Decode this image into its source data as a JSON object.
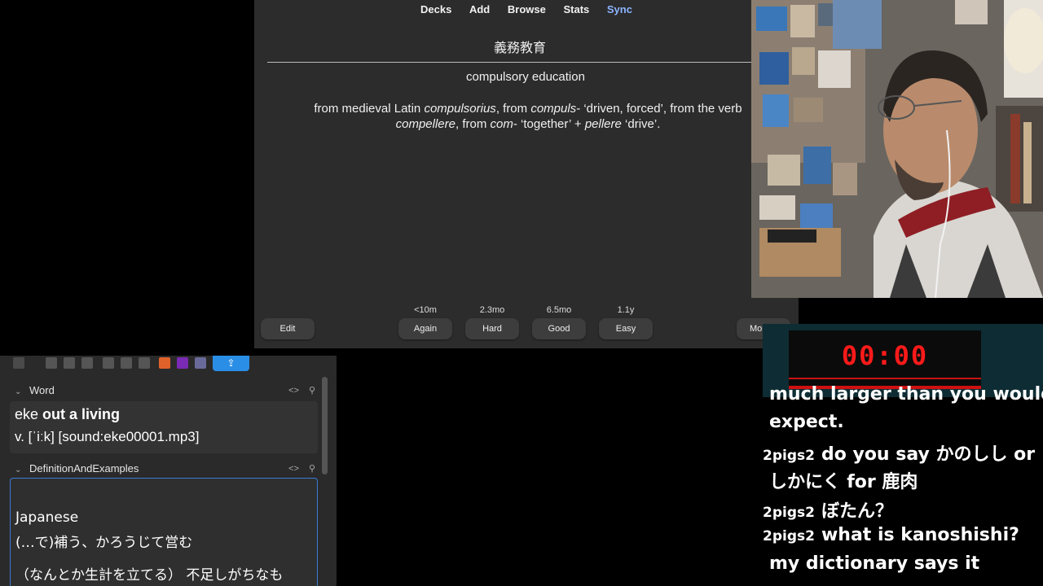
{
  "anki": {
    "nav": [
      "Decks",
      "Add",
      "Browse",
      "Stats",
      "Sync"
    ],
    "nav_active": "Sync",
    "card": {
      "front": "義務教育",
      "meaning": "compulsory education",
      "etymology": [
        {
          "t": "from medieval Latin ",
          "i": false
        },
        {
          "t": "compulsorius",
          "i": true
        },
        {
          "t": ", from ",
          "i": false
        },
        {
          "t": "compuls",
          "i": true
        },
        {
          "t": "- ‘driven, forced’, from the verb ",
          "i": false
        },
        {
          "t": "compellere",
          "i": true
        },
        {
          "t": ", from ",
          "i": false
        },
        {
          "t": "com",
          "i": true
        },
        {
          "t": "- ‘together’ + ",
          "i": false
        },
        {
          "t": "pellere",
          "i": true
        },
        {
          "t": " ‘drive’.",
          "i": false
        }
      ]
    },
    "buttons": {
      "edit": "Edit",
      "again": "Again",
      "hard": "Hard",
      "good": "Good",
      "easy": "Easy",
      "more": "More"
    },
    "intervals": {
      "again": "<10m",
      "hard": "2.3mo",
      "good": "6.5mo",
      "easy": "1.1y"
    }
  },
  "timer": {
    "value": "00:00",
    "color": "#ff1a1a"
  },
  "chat": {
    "lines": [
      {
        "user": "",
        "text": "much larger than you would"
      },
      {
        "user": "",
        "text": "expect."
      },
      {
        "user": "2pigs2",
        "text": "do you say かのしし or"
      },
      {
        "user": "",
        "text": "しかにく for 鹿肉"
      },
      {
        "user": "2pigs2",
        "text": "ぼたん？"
      },
      {
        "user": "2pigs2",
        "text": "what is kanoshishi?"
      },
      {
        "user": "",
        "text": "my dictionary says it"
      }
    ]
  },
  "editor": {
    "fields": {
      "word_label": "Word",
      "def_label": "DefinitionAndExamples"
    },
    "word": {
      "plain": "eke ",
      "bold": "out a living",
      "line2": "v. [ˈiːk] [sound:eke00001.mp3]"
    },
    "definition": {
      "lines": [
        "Japanese",
        "(…で)補う、かろうじて営む",
        "（なんとか生計を立てる） 不足しがちなも"
      ]
    },
    "accent_color": "#2a8ee6"
  }
}
